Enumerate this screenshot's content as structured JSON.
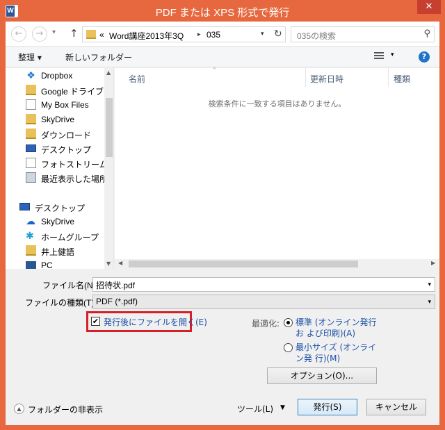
{
  "window": {
    "title": "PDF または XPS 形式で発行",
    "close_glyph": "✕",
    "app_icon_letter": "W"
  },
  "nav": {
    "back_glyph": "←",
    "forward_glyph": "→",
    "recent_glyph": "▾",
    "up_glyph": "↑",
    "breadcrumb_prefix": "«",
    "breadcrumb": [
      "Word講座2013年3Q",
      "035"
    ],
    "crumb_sep": "▸",
    "addr_dropdown": "▾",
    "refresh_glyph": "↻",
    "search_placeholder": "035の検索",
    "search_glyph": "⚲"
  },
  "toolbar": {
    "organize": "整理 ▾",
    "new_folder": "新しいフォルダー",
    "view_dropdown": "▾",
    "help": "?"
  },
  "sidebar": {
    "items": [
      {
        "label": "Dropbox",
        "icon": "dropbox-icon",
        "glyph": "❖"
      },
      {
        "label": "Google ドライブ",
        "icon": "folder-icon",
        "glyph": ""
      },
      {
        "label": "My Box Files",
        "icon": "document-icon",
        "glyph": ""
      },
      {
        "label": "SkyDrive",
        "icon": "folder-icon",
        "glyph": ""
      },
      {
        "label": "ダウンロード",
        "icon": "download-folder-icon",
        "glyph": ""
      },
      {
        "label": "デスクトップ",
        "icon": "desktop-icon",
        "glyph": ""
      },
      {
        "label": "フォトストリーム",
        "icon": "document-icon",
        "glyph": ""
      },
      {
        "label": "最近表示した場所",
        "icon": "recent-places-icon",
        "glyph": ""
      },
      {
        "label": "デスクトップ",
        "icon": "desktop-icon",
        "glyph": ""
      },
      {
        "label": "SkyDrive",
        "icon": "cloud-icon",
        "glyph": "☁"
      },
      {
        "label": "ホームグループ",
        "icon": "homegroup-icon",
        "glyph": "✱"
      },
      {
        "label": "井上健語",
        "icon": "user-folder-icon",
        "glyph": ""
      },
      {
        "label": "PC",
        "icon": "pc-icon",
        "glyph": ""
      }
    ],
    "scroll_up": "▲",
    "scroll_down": "▼"
  },
  "filelist": {
    "columns": [
      "名前",
      "更新日時",
      "種類"
    ],
    "sort_glyph": "^",
    "empty_message": "検索条件に一致する項目はありません。",
    "scroll_left": "◀",
    "scroll_right": "▶"
  },
  "form": {
    "filename_label": "ファイル名(N):",
    "filename_value": "招待状.pdf",
    "filetype_label": "ファイルの種類(T):",
    "filetype_value": "PDF (*.pdf)",
    "dropdown_glyph": "▾",
    "open_after_publish": "発行後にファイルを開く(E)",
    "open_after_publish_checked": "✔",
    "optimize_label": "最適化:",
    "radio_standard": "標準 (オンライン発行お よび印刷)(A)",
    "radio_minimum": "最小サイズ (オンライン発 行)(M)",
    "options_button": "オプション(O)...",
    "hide_folders": "フォルダーの非表示",
    "hide_folders_glyph": "▲",
    "tools": "ツール(L)",
    "tools_dropdown": "▼",
    "publish_button": "発行(S)",
    "cancel_button": "キャンセル"
  },
  "colors": {
    "titlebar": "#e7683e",
    "close_button": "#c7402f",
    "highlight_border": "#d61f26",
    "link_blue": "#1b4fa7"
  }
}
